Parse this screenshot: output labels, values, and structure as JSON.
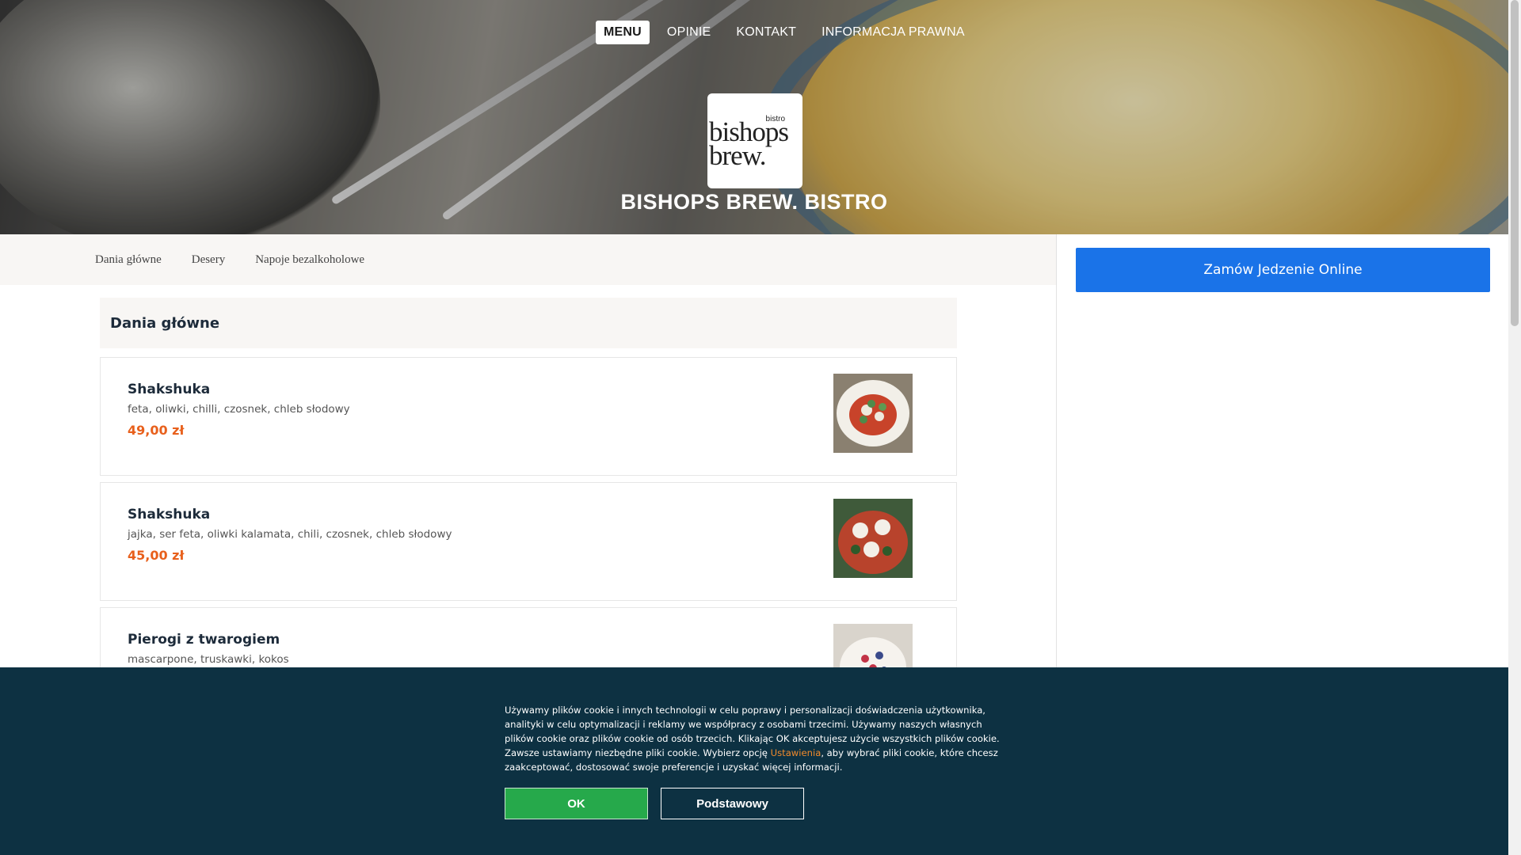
{
  "nav": {
    "items": [
      {
        "label": "MENU",
        "active": true
      },
      {
        "label": "OPINIE",
        "active": false
      },
      {
        "label": "KONTAKT",
        "active": false
      },
      {
        "label": "INFORMACJA PRAWNA",
        "active": false
      }
    ]
  },
  "logo": {
    "small": "bistro",
    "line1": "bishops",
    "line2": "brew."
  },
  "brand": {
    "title": "BISHOPS BREW. BISTRO"
  },
  "categories": [
    "Dania główne",
    "Desery",
    "Napoje bezalkoholowe"
  ],
  "order": {
    "label": "Zamów Jedzenie Online"
  },
  "section": {
    "title": "Dania główne"
  },
  "items": [
    {
      "name": "Shakshuka",
      "desc": "feta, oliwki, chilli, czosnek, chleb słodowy",
      "price": "49,00 zł"
    },
    {
      "name": "Shakshuka",
      "desc": "jajka, ser feta, oliwki kalamata, chili, czosnek, chleb słodowy",
      "price": "45,00 zł"
    },
    {
      "name": "Pierogi z twarogiem",
      "desc": "mascarpone, truskawki, kokos",
      "price": ""
    }
  ],
  "cookie": {
    "text_before": "Używamy plików cookie i innych technologii w celu poprawy i personalizacji doświadczenia użytkownika, analityki w celu optymalizacji i reklamy we współpracy z osobami trzecimi. Używamy naszych własnych plików cookie oraz plików cookie od osób trzecich. Klikając OK akceptujesz użycie wszystkich plików cookie. Zawsze ustawiamy niezbędne pliki cookie. Wybierz opcję ",
    "link": "Ustawienia",
    "text_after": ", aby wybrać pliki cookie, które chcesz zaakceptować, dostosować swoje preferencje i uzyskać więcej informacji.",
    "ok_label": "OK",
    "basic_label": "Podstawowy"
  },
  "colors": {
    "accent_blue": "#1a73e8",
    "price_orange": "#e8601c",
    "cookie_bg": "#0d3142",
    "ok_green": "#26a94b",
    "link_orange": "#f08a2c"
  }
}
